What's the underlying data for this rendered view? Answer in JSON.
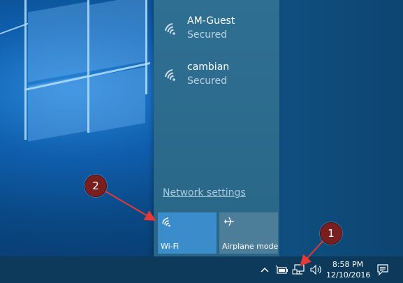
{
  "networks": [
    {
      "name": "AM-Guest",
      "status": "Secured",
      "icon": "wifi-signal-icon"
    },
    {
      "name": "cambian",
      "status": "Secured",
      "icon": "wifi-signal-icon"
    }
  ],
  "flyout": {
    "network_settings": "Network settings",
    "tiles": [
      {
        "label": "Wi-Fi",
        "icon": "wifi-icon",
        "active": true
      },
      {
        "label": "Airplane mode",
        "icon": "airplane-icon",
        "active": false
      }
    ]
  },
  "taskbar": {
    "chevron": "^",
    "time": "8:58 PM",
    "date": "12/10/2016",
    "tray_icons": [
      "power-icon",
      "network-icon",
      "volume-icon",
      "action-center-icon"
    ]
  },
  "annotations": {
    "badge_1": "1",
    "badge_2": "2",
    "color": "#7a1f1f",
    "arrow_color": "#e53935"
  },
  "colors": {
    "tile_active": "#3b8ccb",
    "tile_inactive": "#4c7e9a",
    "taskbar": "#0d3a5a"
  }
}
